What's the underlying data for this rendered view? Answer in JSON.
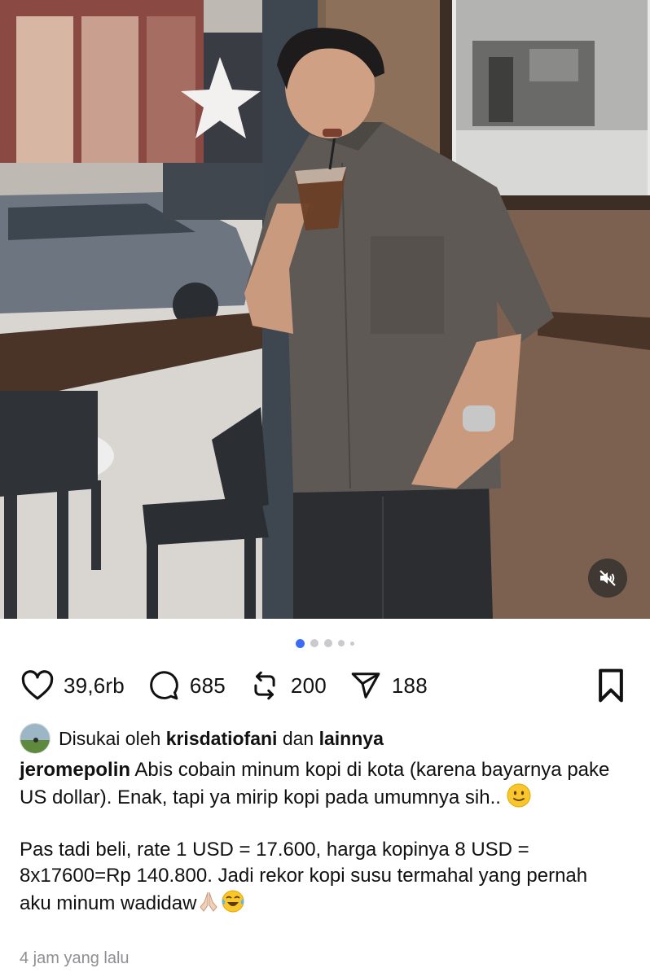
{
  "post": {
    "mute_icon": "speaker-muted-icon",
    "carousel": {
      "count": 5,
      "active_index": 0,
      "active_color": "#3b6cf6"
    },
    "actions": {
      "like_count": "39,6rb",
      "comment_count": "685",
      "repost_count": "200",
      "share_count": "188"
    },
    "likes": {
      "prefix": "Disukai oleh",
      "user": "krisdatiofani",
      "connector": "dan",
      "others": "lainnya"
    },
    "caption": {
      "username": "jeromepolin",
      "text": "Abis cobain minum kopi di kota (karena bayarnya pake US dollar). Enak, tapi ya mirip kopi pada umumnya sih.. ",
      "paragraph2": "Pas tadi beli, rate 1 USD = 17.600, harga kopinya 8 USD = 8x17600=Rp 140.800. Jadi rekor kopi susu termahal yang pernah aku minum wadidaw"
    },
    "timestamp": "4 jam yang lalu"
  }
}
